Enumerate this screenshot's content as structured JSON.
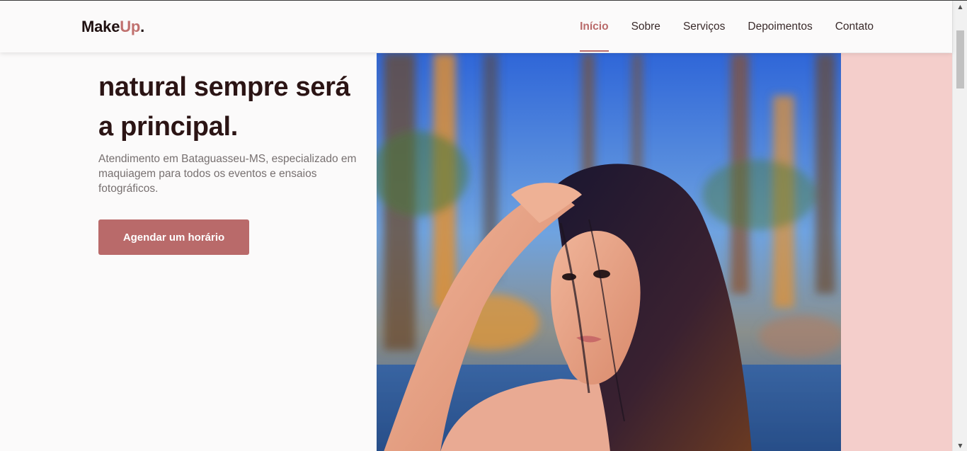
{
  "header": {
    "logo_main": "MakeUp",
    "logo_accent": "Up",
    "logo_prefix": "Make",
    "logo_dot": ".",
    "nav": [
      {
        "label": "Início",
        "active": true
      },
      {
        "label": "Sobre",
        "active": false
      },
      {
        "label": "Serviços",
        "active": false
      },
      {
        "label": "Depoimentos",
        "active": false
      },
      {
        "label": "Contato",
        "active": false
      }
    ]
  },
  "hero": {
    "title_lines": [
      "natural sempre será",
      "a principal."
    ],
    "description": "Atendimento em Bataguasseu-MS, especializado em maquiagem para todos os eventos e ensaios fotográficos.",
    "cta_label": "Agendar um horário"
  },
  "colors": {
    "accent": "#b96a6a",
    "pink_block": "#f4cecb",
    "heading": "#2b1414",
    "background": "#fbfafa"
  }
}
